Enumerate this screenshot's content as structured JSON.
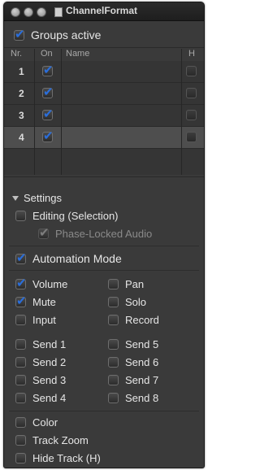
{
  "window": {
    "title": "ChannelFormat"
  },
  "groups_active": {
    "label": "Groups active",
    "checked": true
  },
  "table": {
    "headers": {
      "nr": "Nr.",
      "on": "On",
      "name": "Name",
      "h": "H"
    },
    "rows": [
      {
        "nr": "1",
        "on": true,
        "name": "",
        "h": false
      },
      {
        "nr": "2",
        "on": true,
        "name": "",
        "h": false
      },
      {
        "nr": "3",
        "on": true,
        "name": "",
        "h": false
      },
      {
        "nr": "4",
        "on": true,
        "name": "",
        "h": false,
        "selected": true
      }
    ]
  },
  "settings": {
    "header": "Settings",
    "editing": {
      "label": "Editing (Selection)",
      "checked": false
    },
    "phase_locked": {
      "label": "Phase-Locked Audio",
      "checked": true,
      "enabled": false
    },
    "automation_mode": {
      "label": "Automation Mode",
      "checked": true
    },
    "left_col_1": [
      {
        "label": "Volume",
        "checked": true
      },
      {
        "label": "Mute",
        "checked": true
      },
      {
        "label": "Input",
        "checked": false
      }
    ],
    "right_col_1": [
      {
        "label": "Pan",
        "checked": false
      },
      {
        "label": "Solo",
        "checked": false
      },
      {
        "label": "Record",
        "checked": false
      }
    ],
    "sends_left": [
      {
        "label": "Send 1",
        "checked": false
      },
      {
        "label": "Send 2",
        "checked": false
      },
      {
        "label": "Send 3",
        "checked": false
      },
      {
        "label": "Send 4",
        "checked": false
      }
    ],
    "sends_right": [
      {
        "label": "Send 5",
        "checked": false
      },
      {
        "label": "Send 6",
        "checked": false
      },
      {
        "label": "Send 7",
        "checked": false
      },
      {
        "label": "Send 8",
        "checked": false
      }
    ],
    "bottom": [
      {
        "label": "Color",
        "checked": false
      },
      {
        "label": "Track Zoom",
        "checked": false
      },
      {
        "label": "Hide Track (H)",
        "checked": false
      }
    ]
  }
}
